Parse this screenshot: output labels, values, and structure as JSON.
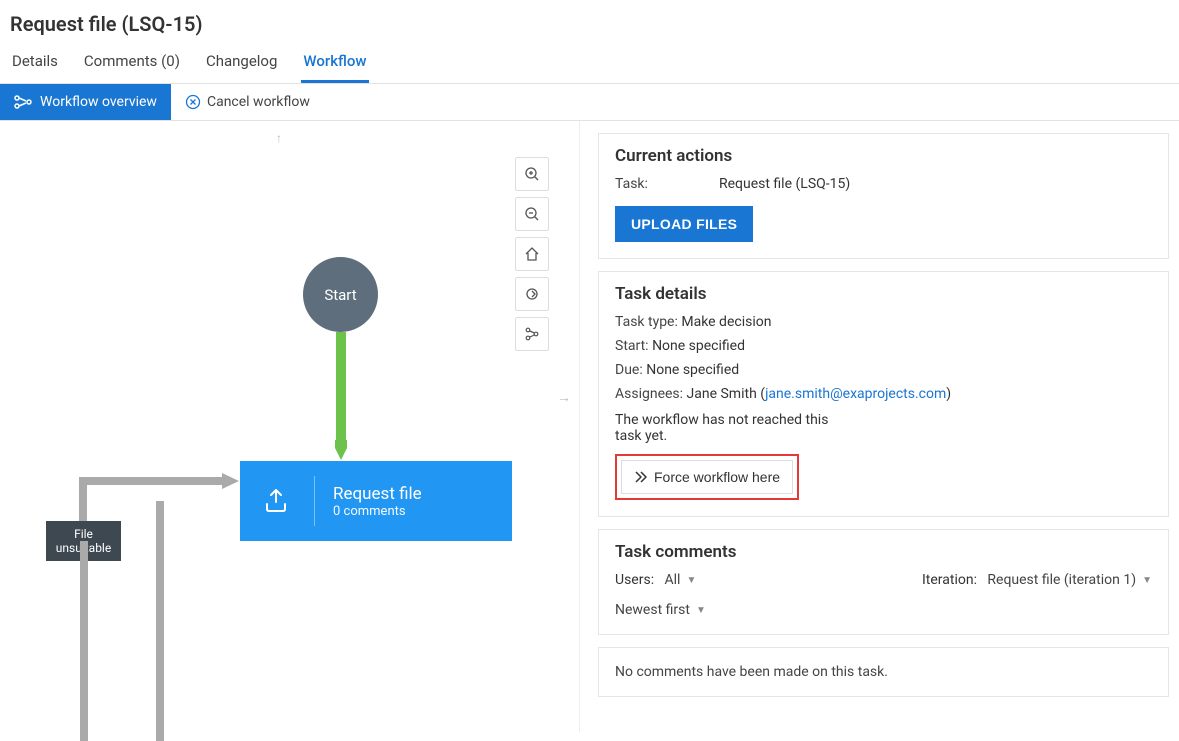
{
  "header": {
    "title": "Request file (LSQ-15)",
    "tabs": [
      {
        "label": "Details"
      },
      {
        "label": "Comments (0)"
      },
      {
        "label": "Changelog"
      },
      {
        "label": "Workflow"
      }
    ]
  },
  "subtoolbar": {
    "overview_label": "Workflow overview",
    "cancel_label": "Cancel workflow"
  },
  "canvas": {
    "start_label": "Start",
    "file_unsuitable_label": "File unsuitable",
    "request_file_title": "Request file",
    "request_file_sub": "0 comments"
  },
  "current_actions": {
    "heading": "Current actions",
    "task_label": "Task:",
    "task_value": "Request file (LSQ-15)",
    "upload_button": "UPLOAD FILES"
  },
  "task_details": {
    "heading": "Task details",
    "type_label": "Task type:",
    "type_value": "Make decision",
    "start_label": "Start:",
    "start_value": "None specified",
    "due_label": "Due:",
    "due_value": "None specified",
    "assignees_label": "Assignees:",
    "assignee_name": "Jane Smith",
    "assignee_email": "jane.smith@exaprojects.com",
    "not_reached_text": "The workflow has not reached this task yet.",
    "force_button": "Force workflow here"
  },
  "comments": {
    "heading": "Task comments",
    "users_label": "Users:",
    "users_value": "All",
    "iteration_label": "Iteration:",
    "iteration_value": "Request file (iteration 1)",
    "sort_value": "Newest first",
    "empty_text": "No comments have been made on this task."
  }
}
